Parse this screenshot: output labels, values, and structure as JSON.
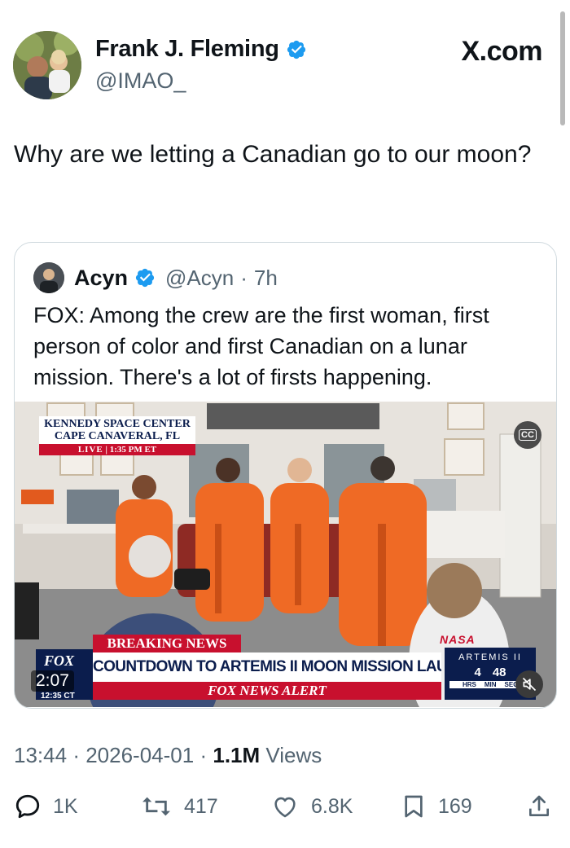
{
  "header": {
    "display_name": "Frank J. Fleming",
    "handle": "@IMAO_",
    "brand": "X.com",
    "avatar_icon": "avatar-photo",
    "verified_icon": "verified-badge-icon"
  },
  "tweet": {
    "text": "Why are we letting a Canadian go to our moon?"
  },
  "quote": {
    "name": "Acyn",
    "handle": "@Acyn",
    "separator": "·",
    "age": "7h",
    "text": "FOX: Among the crew are the first woman, first person of color and first Canadian on a lunar mission. There's a lot of firsts happening."
  },
  "video": {
    "location_line1": "KENNEDY SPACE CENTER",
    "location_line2": "CAPE CANAVERAL, FL",
    "live_label": "LIVE",
    "live_time": "1:35 PM ET",
    "cc_label": "CC",
    "breaking_news": "BREAKING NEWS",
    "headline": "COUNTDOWN TO ARTEMIS II MOON MISSION LAUNCH",
    "alert": "FOX NEWS ALERT",
    "fox_logo": "FOX",
    "duration": "2:07",
    "clock": "12:35 CT",
    "artemis_label": "ARTEMIS II",
    "countdown_hrs": "4",
    "countdown_min": "48",
    "hrs_label": "HRS",
    "min_label": "MIN",
    "sec_label": "SEC",
    "nasa_label": "NASA"
  },
  "meta": {
    "time": "13:44",
    "date": "2026-04-01",
    "views_count": "1.1M",
    "views_label": "Views",
    "dot": "·"
  },
  "actions": {
    "replies": "1K",
    "reposts": "417",
    "likes": "6.8K",
    "bookmarks": "169"
  },
  "colors": {
    "text": "#0f1419",
    "secondary": "#536471",
    "verified": "#1d9bf0",
    "border": "#cfd9de",
    "fox_red": "#c8102e",
    "fox_navy": "#0b1d4d"
  }
}
